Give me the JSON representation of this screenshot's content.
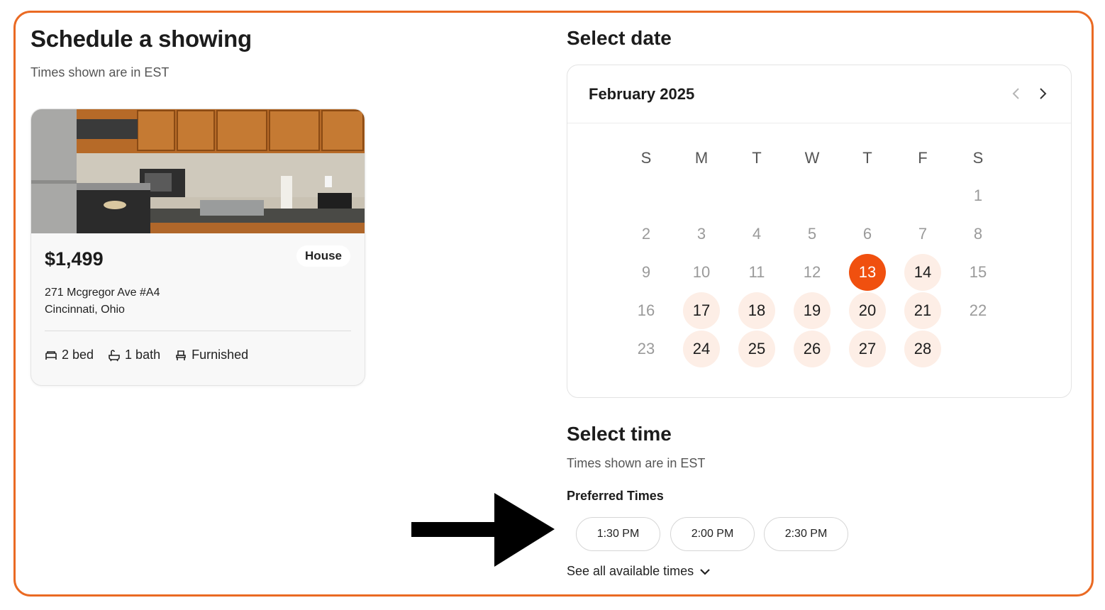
{
  "page": {
    "title": "Schedule a showing",
    "timezone_note": "Times shown are in EST",
    "accent_color": "#f0500f",
    "frame_color": "#ea6a23"
  },
  "listing": {
    "photo_icon": "kitchen-photo",
    "price": "$1,499",
    "type": "House",
    "address_line1": "271 Mcgregor Ave #A4",
    "address_line2": "Cincinnati, Ohio",
    "features": [
      {
        "icon": "bed-icon",
        "label": "2 bed"
      },
      {
        "icon": "bath-icon",
        "label": "1 bath"
      },
      {
        "icon": "chair-icon",
        "label": "Furnished"
      }
    ]
  },
  "date_section": {
    "title": "Select date",
    "month": "February 2025",
    "weekdays": [
      "S",
      "M",
      "T",
      "W",
      "T",
      "F",
      "S"
    ],
    "selected_day": "13",
    "weeks": [
      [
        null,
        null,
        null,
        null,
        null,
        null,
        {
          "d": "1",
          "s": "unavailable"
        }
      ],
      [
        {
          "d": "2",
          "s": "unavailable"
        },
        {
          "d": "3",
          "s": "unavailable"
        },
        {
          "d": "4",
          "s": "unavailable"
        },
        {
          "d": "5",
          "s": "unavailable"
        },
        {
          "d": "6",
          "s": "unavailable"
        },
        {
          "d": "7",
          "s": "unavailable"
        },
        {
          "d": "8",
          "s": "unavailable"
        }
      ],
      [
        {
          "d": "9",
          "s": "unavailable"
        },
        {
          "d": "10",
          "s": "unavailable"
        },
        {
          "d": "11",
          "s": "unavailable"
        },
        {
          "d": "12",
          "s": "unavailable"
        },
        {
          "d": "13",
          "s": "selected"
        },
        {
          "d": "14",
          "s": "available"
        },
        {
          "d": "15",
          "s": "unavailable"
        }
      ],
      [
        {
          "d": "16",
          "s": "unavailable"
        },
        {
          "d": "17",
          "s": "available"
        },
        {
          "d": "18",
          "s": "available"
        },
        {
          "d": "19",
          "s": "available"
        },
        {
          "d": "20",
          "s": "available"
        },
        {
          "d": "21",
          "s": "available"
        },
        {
          "d": "22",
          "s": "unavailable"
        }
      ],
      [
        {
          "d": "23",
          "s": "unavailable"
        },
        {
          "d": "24",
          "s": "available"
        },
        {
          "d": "25",
          "s": "available"
        },
        {
          "d": "26",
          "s": "available"
        },
        {
          "d": "27",
          "s": "available"
        },
        {
          "d": "28",
          "s": "available"
        },
        null
      ]
    ]
  },
  "time_section": {
    "title": "Select time",
    "timezone_note": "Times shown are in EST",
    "preferred_label": "Preferred Times",
    "slots": [
      "1:30 PM",
      "2:00 PM",
      "2:30 PM"
    ],
    "see_all_label": "See all available times"
  },
  "annotation": {
    "icon": "arrow-right-icon"
  }
}
